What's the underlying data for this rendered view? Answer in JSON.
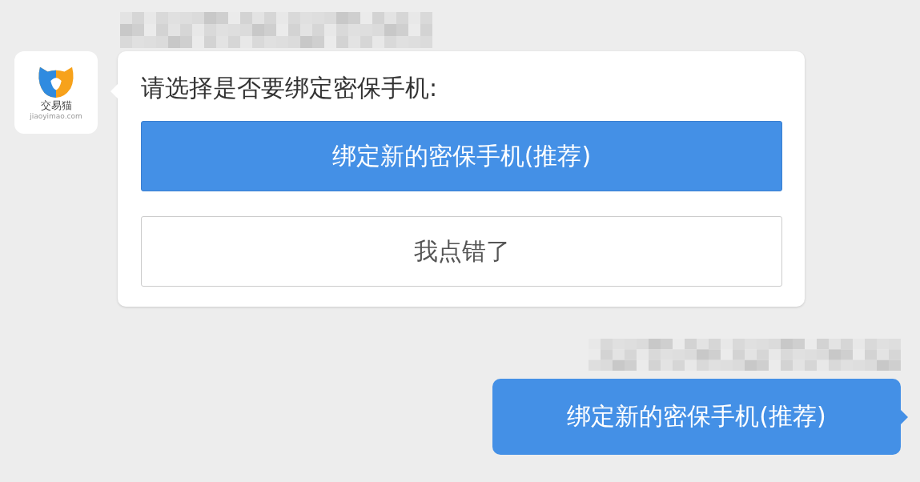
{
  "incoming": {
    "avatar": {
      "brand": "交易猫",
      "domain": "jiaoyimao.com"
    },
    "prompt": "请选择是否要绑定密保手机:",
    "options": [
      {
        "label": "绑定新的密保手机(推荐)",
        "kind": "primary"
      },
      {
        "label": "我点错了",
        "kind": "secondary"
      }
    ]
  },
  "outgoing": {
    "text": "绑定新的密保手机(推荐)"
  }
}
